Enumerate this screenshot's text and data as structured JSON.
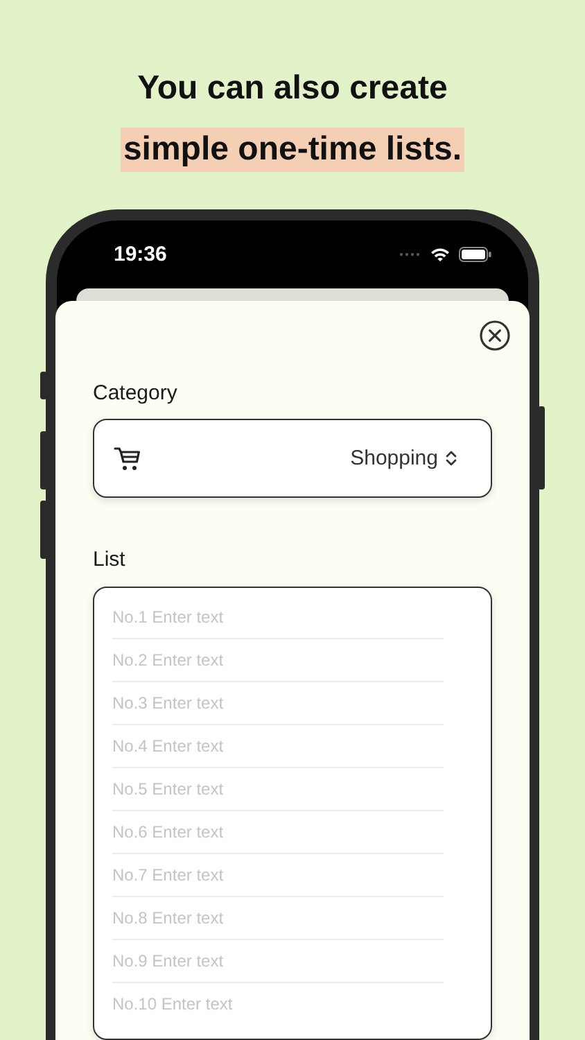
{
  "headline": {
    "line_1": "You can also create",
    "line_2": "simple one-time lists."
  },
  "status_bar": {
    "time": "19:36"
  },
  "category": {
    "label": "Category",
    "value": "Shopping"
  },
  "list": {
    "label": "List",
    "items": [
      {
        "placeholder": "No.1 Enter text"
      },
      {
        "placeholder": "No.2 Enter text"
      },
      {
        "placeholder": "No.3 Enter text"
      },
      {
        "placeholder": "No.4 Enter text"
      },
      {
        "placeholder": "No.5 Enter text"
      },
      {
        "placeholder": "No.6 Enter text"
      },
      {
        "placeholder": "No.7 Enter text"
      },
      {
        "placeholder": "No.8 Enter text"
      },
      {
        "placeholder": "No.9 Enter text"
      },
      {
        "placeholder": "No.10 Enter text"
      }
    ]
  }
}
